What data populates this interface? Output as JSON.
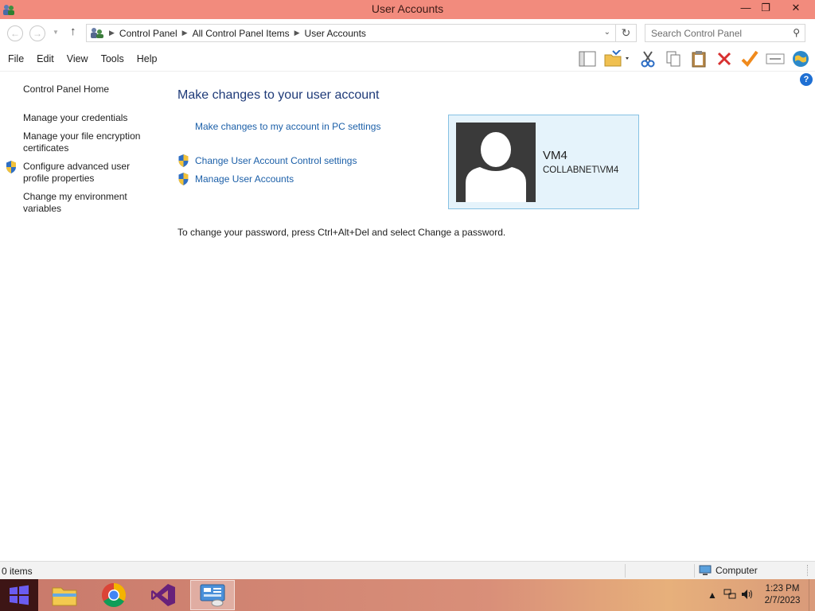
{
  "window": {
    "title": "User Accounts",
    "minimize": "—",
    "restore": "❐",
    "close": "✕"
  },
  "address": {
    "back_glyph": "←",
    "forward_glyph": "→",
    "up_glyph": "↑",
    "breadcrumbs": [
      "Control Panel",
      "All Control Panel Items",
      "User Accounts"
    ],
    "refresh_glyph": "↻",
    "search_placeholder": "Search Control Panel"
  },
  "menu": [
    "File",
    "Edit",
    "View",
    "Tools",
    "Help"
  ],
  "toolbar_icons": [
    "layout-icon",
    "properties-folder-icon",
    "cut-icon",
    "copy-icon",
    "paste-icon",
    "delete-icon",
    "checkmark-icon",
    "rename-icon",
    "globe-icon"
  ],
  "help": "?",
  "sidebar": {
    "home": "Control Panel Home",
    "items": [
      {
        "label": "Manage your credentials",
        "shield": false
      },
      {
        "label": "Manage your file encryption certificates",
        "shield": false
      },
      {
        "label": "Configure advanced user profile properties",
        "shield": true
      },
      {
        "label": "Change my environment variables",
        "shield": false
      }
    ]
  },
  "main": {
    "heading": "Make changes to your user account",
    "pc_settings_link": "Make changes to my account in PC settings",
    "uac_link": "Change User Account Control settings",
    "manage_link": "Manage User Accounts",
    "password_note": "To change your password, press Ctrl+Alt+Del and select Change a password."
  },
  "user": {
    "name": "VM4",
    "domain": "COLLABNET\\VM4"
  },
  "status": {
    "items": "0 items",
    "zone": "Computer"
  },
  "taskbar": {
    "apps": [
      "file-explorer-icon",
      "chrome-icon",
      "visual-studio-icon",
      "control-panel-icon"
    ],
    "time": "1:23 PM",
    "date": "2/7/2023"
  },
  "colors": {
    "titlebar": "#f28b7d",
    "link": "#1b5fa8",
    "heading": "#1e3a78",
    "card_bg": "#e5f3fb",
    "card_border": "#86c1e3"
  }
}
